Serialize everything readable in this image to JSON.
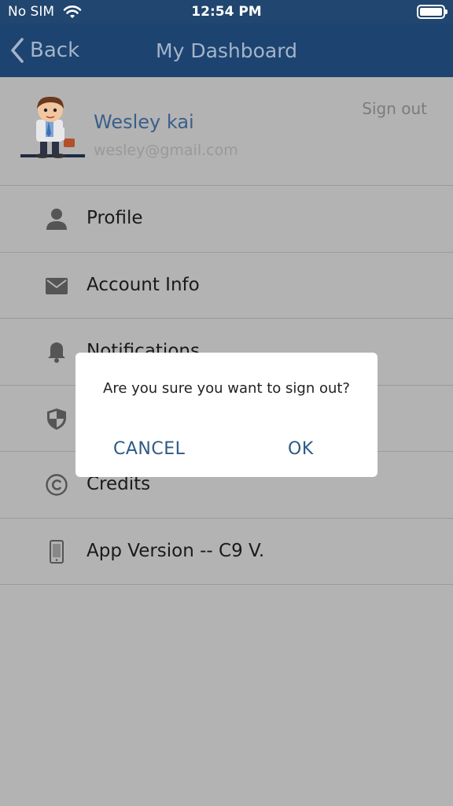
{
  "status_bar": {
    "carrier": "No SIM",
    "time": "12:54 PM",
    "wifi_icon": "wifi-icon",
    "battery_icon": "battery-icon"
  },
  "nav": {
    "back_label": "Back",
    "title": "My Dashboard"
  },
  "profile": {
    "name": "Wesley kai",
    "email": "wesley@gmail.com",
    "sign_out": "Sign out"
  },
  "menu": {
    "items": [
      {
        "label": "Profile",
        "icon": "person-icon"
      },
      {
        "label": "Account Info",
        "icon": "envelope-icon"
      },
      {
        "label": "Notifications",
        "icon": "bell-icon"
      },
      {
        "label": "",
        "icon": "shield-icon"
      },
      {
        "label": "Credits",
        "icon": "copyright-icon"
      },
      {
        "label": "App Version -- C9 V.",
        "icon": "phone-icon"
      }
    ]
  },
  "dialog": {
    "message": "Are you sure you want to sign out?",
    "cancel": "CANCEL",
    "ok": "OK"
  },
  "colors": {
    "nav_bg": "#1d4370",
    "overlay_bg": "#b3b3b3",
    "link_blue": "#2e5a86",
    "name_blue": "#3a5f8a"
  }
}
